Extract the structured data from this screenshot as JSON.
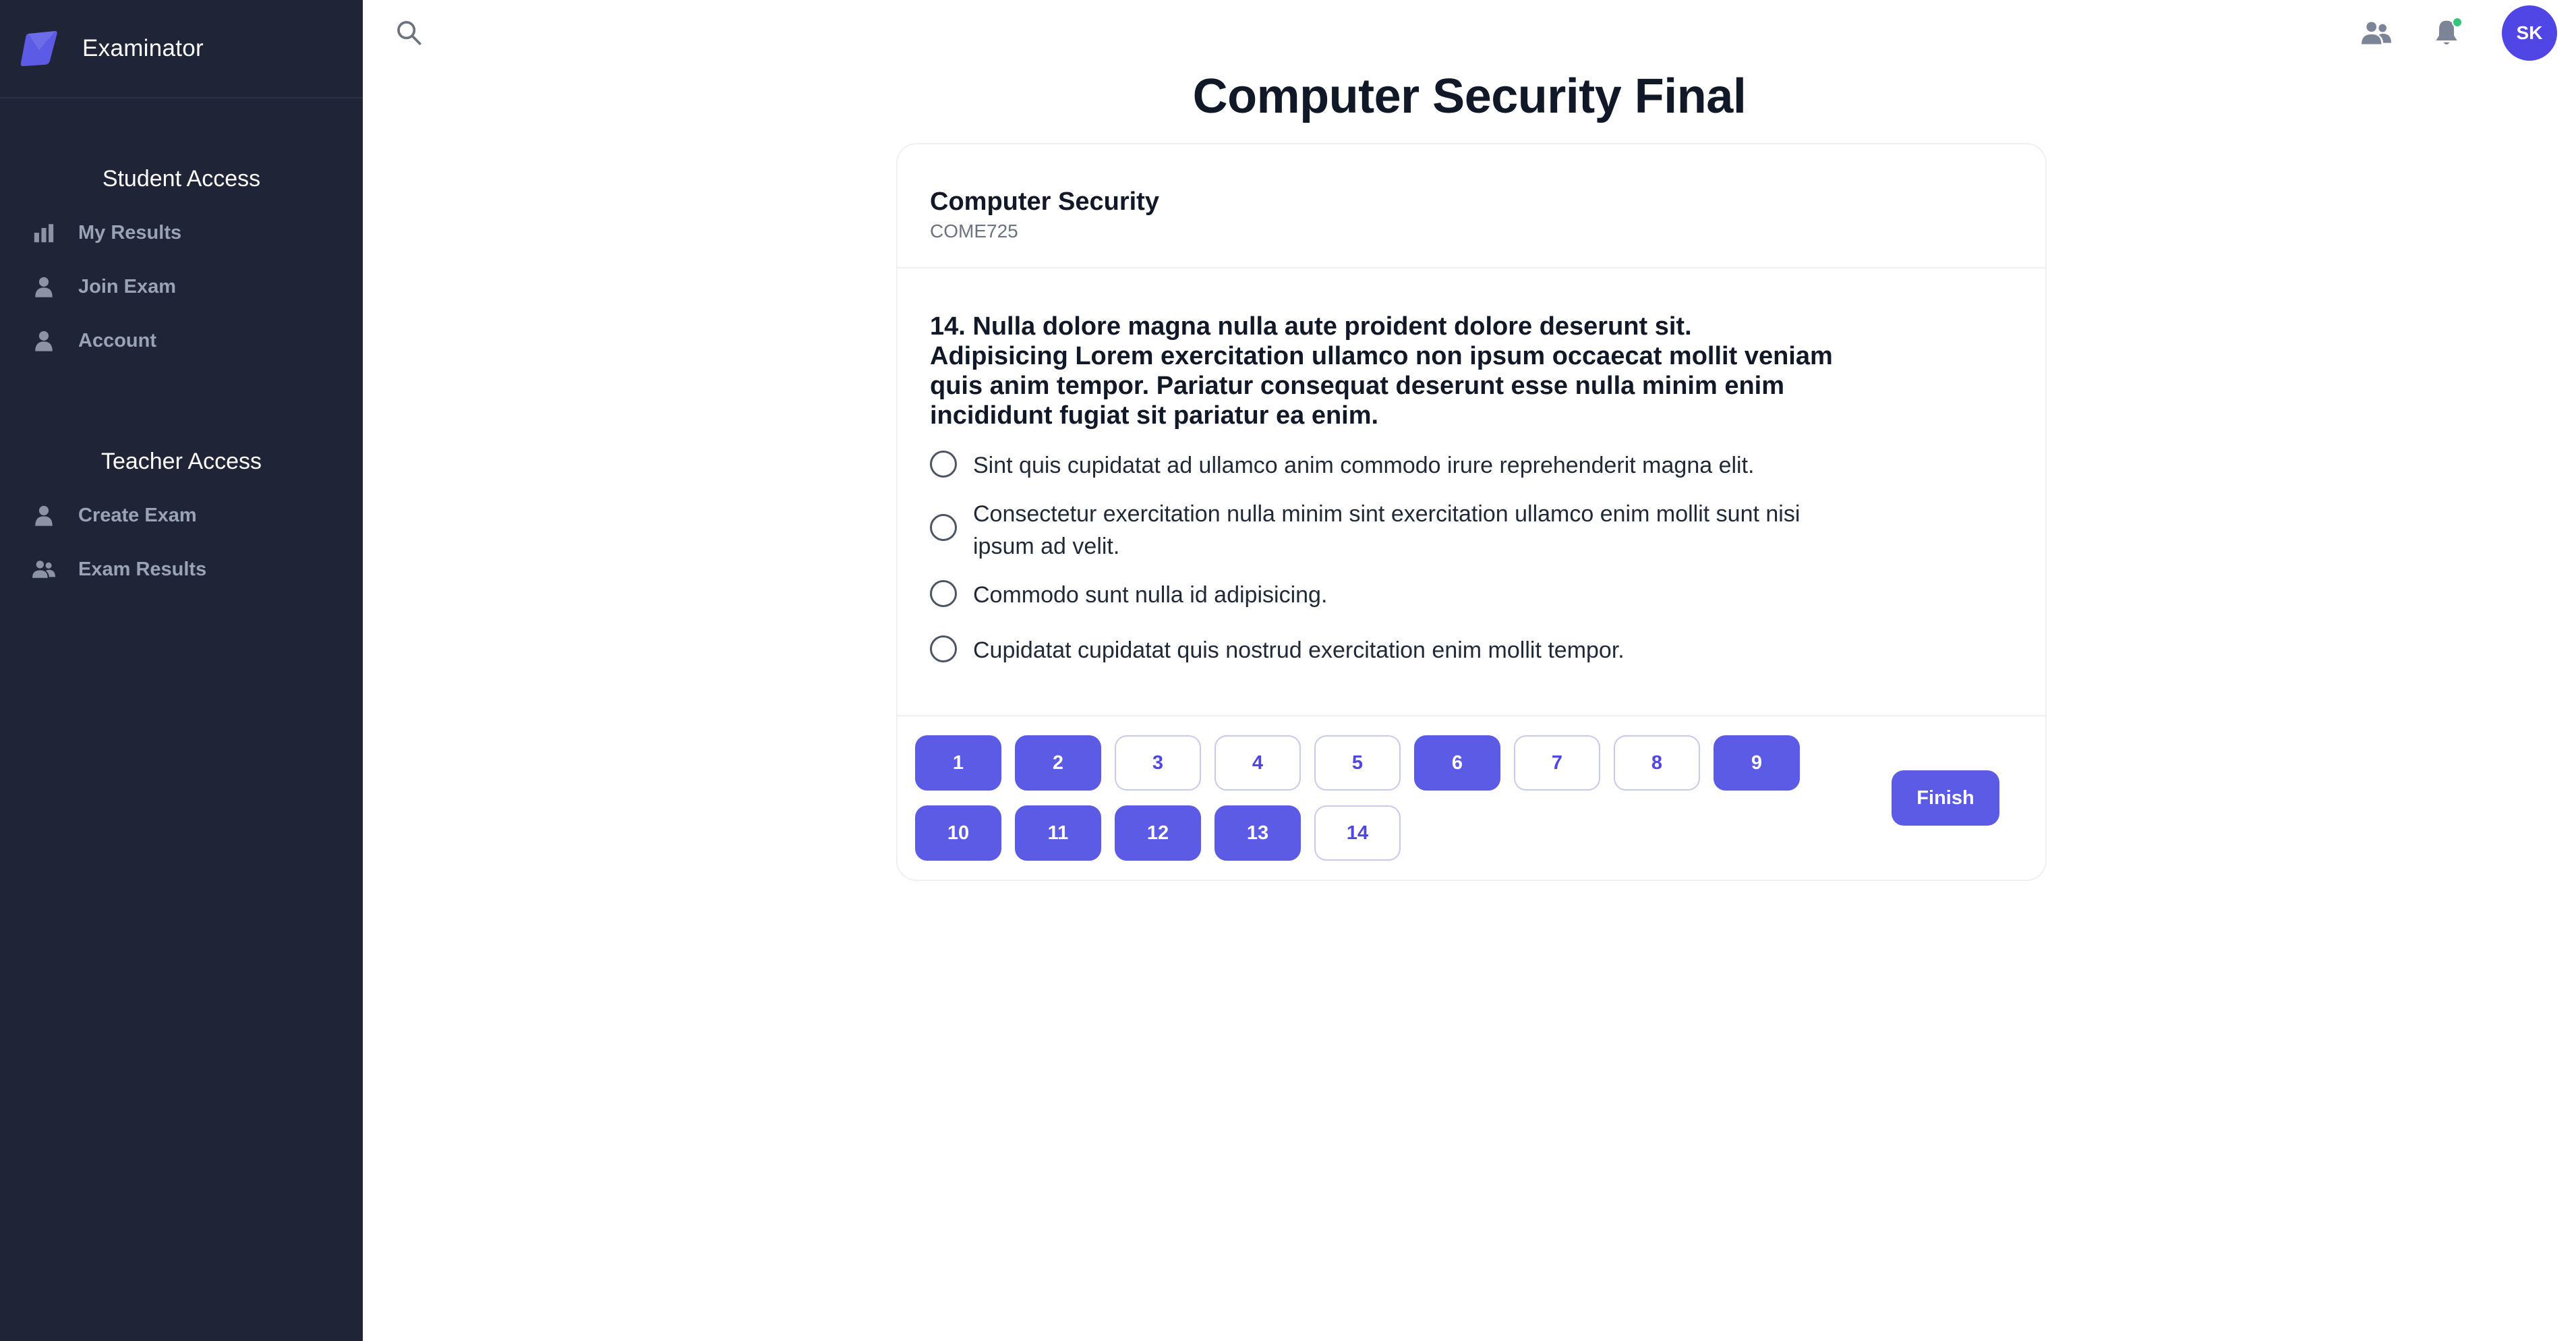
{
  "brand": {
    "name": "Examinator"
  },
  "sidebar": {
    "student_section": {
      "title": "Student Access",
      "items": [
        {
          "label": "My Results",
          "icon": "bar-chart-icon"
        },
        {
          "label": "Join Exam",
          "icon": "user-icon"
        },
        {
          "label": "Account",
          "icon": "user-icon"
        }
      ]
    },
    "teacher_section": {
      "title": "Teacher Access",
      "items": [
        {
          "label": "Create Exam",
          "icon": "user-icon"
        },
        {
          "label": "Exam Results",
          "icon": "users-icon"
        }
      ]
    }
  },
  "topbar": {
    "avatar_initials": "SK",
    "notification_dot_color": "#34c77b"
  },
  "page": {
    "title": "Computer Security Final"
  },
  "course": {
    "name": "Computer Security",
    "code": "COME725"
  },
  "question": {
    "text": "14. Nulla dolore magna nulla aute proident dolore deserunt sit. Adipisicing Lorem exercitation ullamco non ipsum occaecat mollit veniam quis anim tempor. Pariatur consequat deserunt esse nulla minim enim incididunt fugiat sit pariatur ea enim.",
    "options": [
      "Sint quis cupidatat ad ullamco anim commodo irure reprehenderit magna elit.",
      "Consectetur exercitation nulla minim sint exercitation ullamco enim mollit sunt nisi ipsum ad velit.",
      "Commodo sunt nulla id adipisicing.",
      "Cupidatat cupidatat quis nostrud exercitation enim mollit tempor."
    ]
  },
  "navigation": {
    "questions": [
      {
        "label": "1",
        "answered": true
      },
      {
        "label": "2",
        "answered": true
      },
      {
        "label": "3",
        "answered": false
      },
      {
        "label": "4",
        "answered": false
      },
      {
        "label": "5",
        "answered": false
      },
      {
        "label": "6",
        "answered": true
      },
      {
        "label": "7",
        "answered": false
      },
      {
        "label": "8",
        "answered": false
      },
      {
        "label": "9",
        "answered": true
      },
      {
        "label": "10",
        "answered": true
      },
      {
        "label": "11",
        "answered": true
      },
      {
        "label": "12",
        "answered": true
      },
      {
        "label": "13",
        "answered": true
      },
      {
        "label": "14",
        "answered": false
      }
    ],
    "finish_label": "Finish"
  },
  "colors": {
    "sidebar_bg": "#1f2537",
    "accent": "#5b5be6",
    "avatar_bg": "#4f46e5"
  }
}
